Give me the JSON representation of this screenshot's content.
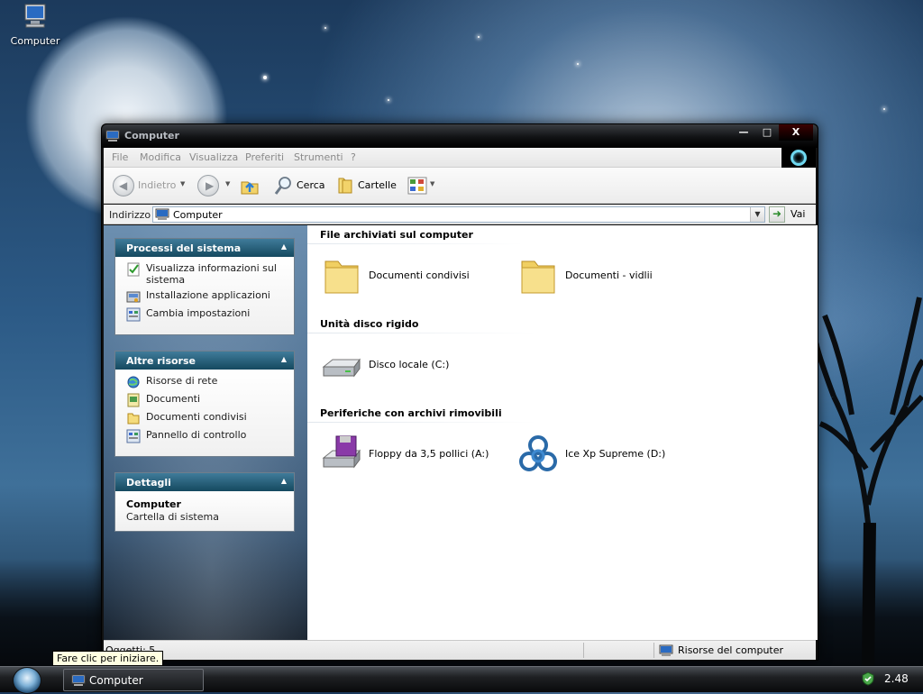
{
  "desktop": {
    "icon_label": "Computer",
    "tooltip": "Fare clic per iniziare."
  },
  "window": {
    "title": "Computer",
    "controls": {
      "min": "—",
      "max": "□",
      "close": "X"
    },
    "menu": [
      "File",
      "Modifica",
      "Visualizza",
      "Preferiti",
      "Strumenti",
      "?"
    ],
    "toolbar": {
      "back_label": "Indietro",
      "search_label": "Cerca",
      "folders_label": "Cartelle"
    },
    "address": {
      "label": "Indirizzo",
      "value": "Computer",
      "go_label": "Vai"
    },
    "panels": {
      "system": {
        "title": "Processi del sistema",
        "items": [
          "Visualizza informazioni sul sistema",
          "Installazione applicazioni",
          "Cambia impostazioni"
        ]
      },
      "other": {
        "title": "Altre risorse",
        "items": [
          "Risorse di rete",
          "Documenti",
          "Documenti condivisi",
          "Pannello di controllo"
        ]
      },
      "details": {
        "title": "Dettagli",
        "name": "Computer",
        "type": "Cartella di sistema"
      }
    },
    "groups": [
      {
        "header": "File archiviati sul computer",
        "items": [
          "Documenti condivisi",
          "Documenti - vidlii"
        ]
      },
      {
        "header": "Unità disco rigido",
        "items": [
          "Disco locale (C:)"
        ]
      },
      {
        "header": "Periferiche con archivi rimovibili",
        "items": [
          "Floppy da 3,5 pollici (A:)",
          "Ice Xp Supreme (D:)"
        ]
      }
    ],
    "status": {
      "objects": "Oggetti: 5",
      "location": "Risorse del computer"
    }
  },
  "taskbar": {
    "task_label": "Computer",
    "clock": "2.48"
  },
  "colors": {
    "panel_header": "#15495f",
    "titlebar": "#111214",
    "taskbar": "#1e2023"
  }
}
